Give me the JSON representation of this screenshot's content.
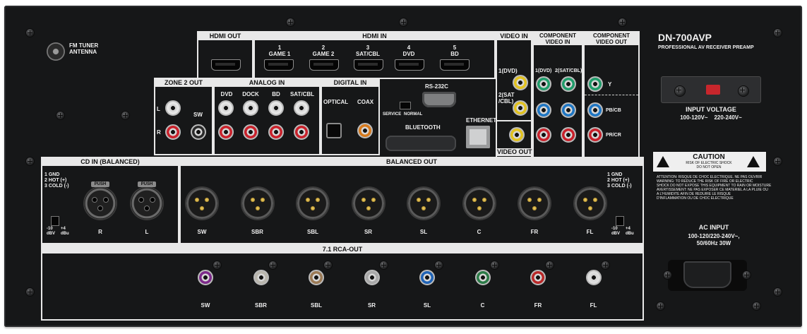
{
  "model": {
    "name": "DN-700AVP",
    "subtitle": "PROFESSIONAL AV RECEIVER PREAMP"
  },
  "fm_tuner": {
    "label": "FM TUNER\nANTENNA"
  },
  "hdmi_out": {
    "title": "HDMI OUT"
  },
  "hdmi_in": {
    "title": "HDMI IN",
    "ports": [
      {
        "number": "1",
        "name": "GAME 1"
      },
      {
        "number": "2",
        "name": "GAME 2"
      },
      {
        "number": "3",
        "name": "SAT/CBL"
      },
      {
        "number": "4",
        "name": "DVD"
      },
      {
        "number": "5",
        "name": "BD"
      }
    ]
  },
  "video_in": {
    "title": "VIDEO IN",
    "labels": [
      "1(DVD)",
      "2(SAT\n/CBL)"
    ]
  },
  "video_out": {
    "title": "VIDEO OUT"
  },
  "component_in": {
    "title": "COMPONENT\nVIDEO IN",
    "labels": [
      "1(DVD)",
      "2(SAT/CBL)"
    ]
  },
  "component_out": {
    "title": "COMPONENT\nVIDEO OUT",
    "labels": [
      "Y",
      "PB/CB",
      "PR/CR"
    ]
  },
  "zone2": {
    "title": "ZONE 2 OUT",
    "labels": [
      "L",
      "R",
      "SW"
    ]
  },
  "analog_in": {
    "title": "ANALOG IN",
    "inputs": [
      "DVD",
      "DOCK",
      "BD",
      "SAT/CBL"
    ]
  },
  "digital_in": {
    "title": "DIGITAL IN",
    "inputs": [
      "OPTICAL",
      "COAX"
    ]
  },
  "rs232c": {
    "label": "RS-232C",
    "switch_labels": [
      "SERVICE",
      "NORMAL"
    ]
  },
  "ethernet": {
    "label": "ETHERNET"
  },
  "bluetooth": {
    "label": "BLUETOOTH"
  },
  "input_voltage": {
    "title": "INPUT VOLTAGE",
    "value": "100-120V~    220-240V~"
  },
  "caution": {
    "title": "CAUTION",
    "line1": "RISK OF ELECTRIC SHOCK",
    "line2": "DO NOT OPEN",
    "text": "ATTENTION: RISQUE DE CHOC ELECTRIQUE. NE PAS OUVRIR\nWARNING: TO REDUCE THE RISK OF FIRE OR ELECTRIC\nSHOCK DO NOT EXPOSE THIS EQUIPMENT TO RAIN OR MOISTURE\nAVERTISSEMENT: NE PAS EXPOSER CE MATERIEL A LA PLUIE OU\nA L'HUMIDITE AFIN DE REDUIRE LE RISQUE\nD'INFLAMMATION OU DE CHOC ELECTRIQUE"
  },
  "cd_in": {
    "title": "CD IN (BALANCED)",
    "pins": "1 GND\n2 HOT (+)\n3 COLD (-)",
    "push": "PUSH",
    "channels": [
      "R",
      "L"
    ],
    "level": {
      "low": "-10\ndBV",
      "high": "+4\ndBu"
    }
  },
  "balanced_out": {
    "title": "BALANCED OUT",
    "pins": "1 GND\n2 HOT (+)\n3 COLD (-)",
    "channels": [
      "SW",
      "SBR",
      "SBL",
      "SR",
      "SL",
      "C",
      "FR",
      "FL"
    ],
    "level": {
      "low": "-10\ndBV",
      "high": "+4\ndBu"
    }
  },
  "rca_out": {
    "title": "7.1 RCA-OUT",
    "channels": [
      "SW",
      "SBR",
      "SBL",
      "SR",
      "SL",
      "C",
      "FR",
      "FL"
    ],
    "colors": [
      "#7d2a8a",
      "#b9b6ad",
      "#9b7a55",
      "#a9a9a9",
      "#1f63b6",
      "#2b7b47",
      "#b92828",
      "#dedede"
    ]
  },
  "ac_input": {
    "title": "AC INPUT",
    "spec": "100-120/220-240V~,\n50/60Hz 30W"
  },
  "colors": {
    "panel": "#161718",
    "label_bg": "#e8e8e8",
    "rca_red": "#c9202a",
    "rca_white": "#e6e6e6",
    "video_yellow": "#e2c21e",
    "comp_green": "#1f9c6a",
    "comp_blue": "#1e76c4",
    "comp_red": "#c9202a"
  }
}
